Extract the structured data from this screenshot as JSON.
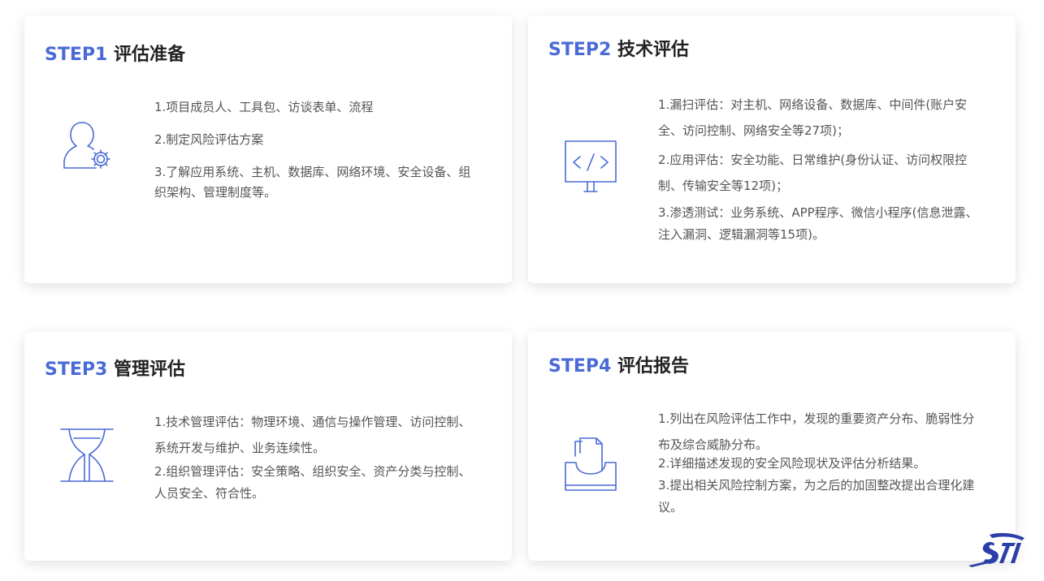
{
  "cards": [
    {
      "step": "STEP1",
      "title": "评估准备",
      "icon": "user-gear-icon",
      "items": [
        "1.项目成员人、工具包、访谈表单、流程",
        "2.制定风险评估方案",
        "3.了解应用系统、主机、数据库、网络环境、安全设备、组织架构、管理制度等。"
      ]
    },
    {
      "step": "STEP2",
      "title": "技术评估",
      "icon": "code-monitor-icon",
      "items": [
        "1.漏扫评估：对主机、网络设备、数据库、中间件(账户安全、访问控制、网络安全等27项)；",
        "2.应用评估：安全功能、日常维护(身份认证、访问权限控制、传输安全等12项)；",
        "3.渗透测试：业务系统、APP程序、微信小程序(信息泄露、注入漏洞、逻辑漏洞等15项)。"
      ]
    },
    {
      "step": "STEP3",
      "title": "管理评估",
      "icon": "hourglass-icon",
      "items": [
        "1.技术管理评估：物理环境、通信与操作管理、访问控制、系统开发与维护、业务连续性。",
        "2.组织管理评估：安全策略、组织安全、资产分类与控制、人员安全、符合性。"
      ]
    },
    {
      "step": "STEP4",
      "title": "评估报告",
      "icon": "document-tray-icon",
      "items": [
        "1.列出在风险评估工作中，发现的重要资产分布、脆弱性分布及综合威胁分布。",
        "2.详细描述发现的安全风险现状及评估分析结果。",
        "3.提出相关风险控制方案，为之后的加固整改提出合理化建议。"
      ]
    }
  ],
  "logo": {
    "icon": "company-logo-icon"
  },
  "colors": {
    "accent": "#4a6ad6",
    "title": "#222222",
    "body": "#555555",
    "logo": "#2c3fa8"
  }
}
